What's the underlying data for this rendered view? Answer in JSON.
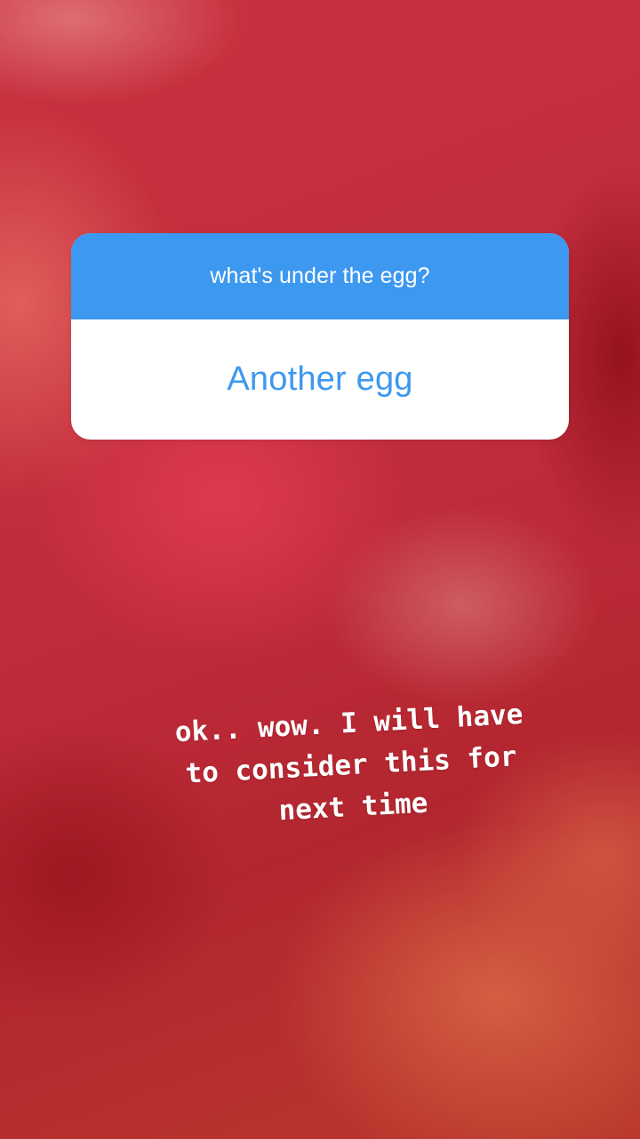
{
  "question_sticker": {
    "question": "what's under the egg?",
    "answer": "Another egg"
  },
  "caption": {
    "lines": [
      "ok.. wow. I will have",
      "to consider this for",
      "next time"
    ]
  },
  "colors": {
    "accent": "#3d98f0",
    "card_background": "#ffffff",
    "caption_text": "#ffffff",
    "background_primary": "#c42f3d"
  }
}
